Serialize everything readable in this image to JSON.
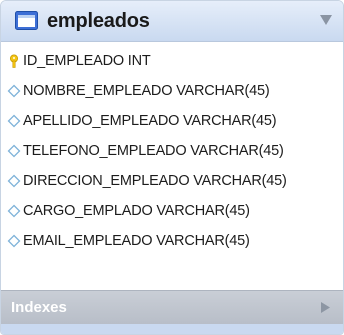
{
  "table": {
    "title": "empleados",
    "icon": "table-icon",
    "collapse_icon": "triangle-down-icon",
    "columns": [
      {
        "label": "ID_EMPLEADO INT",
        "icon": "primary-key-icon"
      },
      {
        "label": "NOMBRE_EMPLEADO VARCHAR(45)",
        "icon": "column-diamond-icon"
      },
      {
        "label": "APELLIDO_EMPLEADO VARCHAR(45)",
        "icon": "column-diamond-icon"
      },
      {
        "label": "TELEFONO_EMPLEADO VARCHAR(45)",
        "icon": "column-diamond-icon"
      },
      {
        "label": "DIRECCION_EMPLEADO VARCHAR(45)",
        "icon": "column-diamond-icon"
      },
      {
        "label": "CARGO_EMPLADO VARCHAR(45)",
        "icon": "column-diamond-icon"
      },
      {
        "label": "EMAIL_EMPLEADO VARCHAR(45)",
        "icon": "column-diamond-icon"
      }
    ],
    "indexes": {
      "label": "Indexes",
      "expand_icon": "triangle-right-icon"
    }
  },
  "colors": {
    "header_top": "#e6eefa",
    "header_bottom": "#c9d9f0",
    "indexes_bar": "#c0c6cf",
    "key_icon": "#f2c200",
    "diamond_icon": "#7fb3d9"
  }
}
